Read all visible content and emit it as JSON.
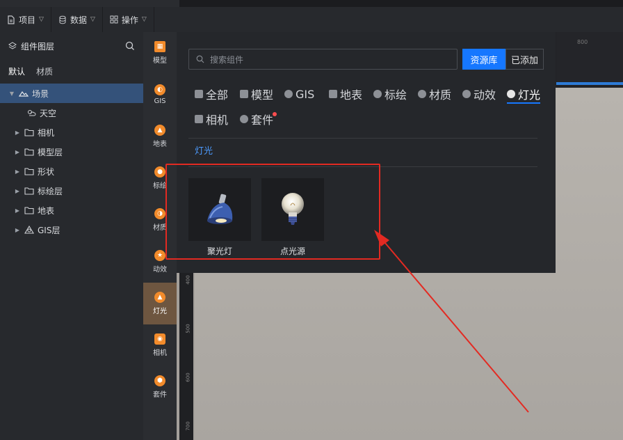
{
  "menubar": {
    "items": [
      {
        "label": "项目",
        "icon": "file-icon"
      },
      {
        "label": "数据",
        "icon": "database-icon"
      },
      {
        "label": "操作",
        "icon": "grid-icon"
      }
    ]
  },
  "layers": {
    "title": "组件图层",
    "tabs": [
      "默认",
      "材质"
    ],
    "tree": [
      {
        "label": "场景",
        "icon": "scene-icon",
        "expanded": true,
        "selected": true
      },
      {
        "label": "天空",
        "icon": "sky-icon"
      },
      {
        "label": "相机",
        "icon": "folder-icon"
      },
      {
        "label": "模型层",
        "icon": "folder-icon"
      },
      {
        "label": "形状",
        "icon": "folder-icon"
      },
      {
        "label": "标绘层",
        "icon": "folder-icon"
      },
      {
        "label": "地表",
        "icon": "folder-icon"
      },
      {
        "label": "GIS层",
        "icon": "gis-icon"
      }
    ]
  },
  "categories": [
    {
      "label": "模型",
      "icon": "model-icon"
    },
    {
      "label": "GIS",
      "icon": "gis-icon"
    },
    {
      "label": "地表",
      "icon": "terrain-icon"
    },
    {
      "label": "标绘",
      "icon": "marker-icon"
    },
    {
      "label": "材质",
      "icon": "material-icon"
    },
    {
      "label": "动效",
      "icon": "effect-icon"
    },
    {
      "label": "灯光",
      "icon": "light-icon",
      "active": true
    },
    {
      "label": "相机",
      "icon": "camera-icon"
    },
    {
      "label": "套件",
      "icon": "kit-icon"
    }
  ],
  "popup": {
    "search_placeholder": "搜索组件",
    "seg_library": "资源库",
    "seg_added": "已添加",
    "filter_tabs": [
      {
        "label": "全部"
      },
      {
        "label": "模型"
      },
      {
        "label": "GIS"
      },
      {
        "label": "地表"
      },
      {
        "label": "标绘"
      },
      {
        "label": "材质"
      },
      {
        "label": "动效"
      },
      {
        "label": "灯光",
        "active": true
      },
      {
        "label": "相机"
      },
      {
        "label": "套件",
        "badge": true
      }
    ],
    "section_title": "灯光",
    "items": [
      {
        "label": "聚光灯",
        "icon": "spotlight-icon"
      },
      {
        "label": "点光源",
        "icon": "bulb-icon"
      }
    ]
  },
  "ruler": {
    "h_label": "800",
    "v_labels": [
      "400",
      "500",
      "600",
      "700"
    ]
  },
  "colors": {
    "accent": "#1677ff",
    "highlight_box": "#e32a22",
    "selected_row": "#34527a",
    "active_category": "#6e5640"
  }
}
